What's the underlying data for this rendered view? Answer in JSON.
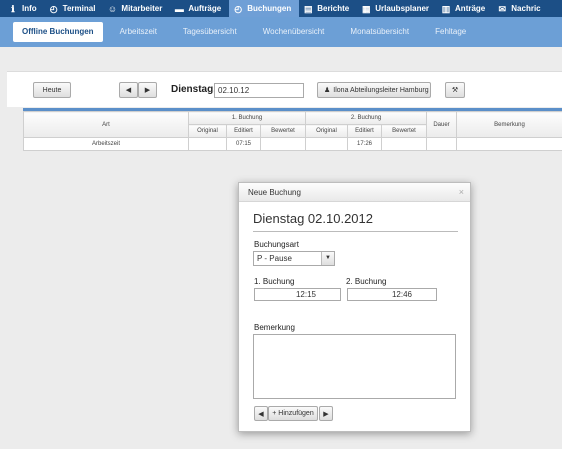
{
  "topnav": {
    "items": [
      {
        "label": "Info",
        "icon": "info-icon",
        "glyph": "ℹ"
      },
      {
        "label": "Terminal",
        "icon": "clock-icon",
        "glyph": "◴"
      },
      {
        "label": "Mitarbeiter",
        "icon": "users-icon",
        "glyph": "☺"
      },
      {
        "label": "Aufträge",
        "icon": "folder-icon",
        "glyph": "▬"
      },
      {
        "label": "Buchungen",
        "icon": "clock-icon",
        "glyph": "◴"
      },
      {
        "label": "Berichte",
        "icon": "report-icon",
        "glyph": "▤"
      },
      {
        "label": "Urlaubsplaner",
        "icon": "calendar-icon",
        "glyph": "▦"
      },
      {
        "label": "Anträge",
        "icon": "document-icon",
        "glyph": "▥"
      },
      {
        "label": "Nachric",
        "icon": "mail-icon",
        "glyph": "✉"
      }
    ],
    "active_index": 4
  },
  "subnav": {
    "items": [
      "Offline Buchungen",
      "Arbeitszeit",
      "Tagesübersicht",
      "Wochenübersicht",
      "Monatsübersicht",
      "Fehltage"
    ],
    "active_index": 0
  },
  "toolbar": {
    "today_label": "Heute",
    "date_label": "Dienstag,",
    "date_value": "02.10.12",
    "employee_label": "Ilona Abteilungsleiter Hamburg"
  },
  "grid": {
    "headers": {
      "art": "Art",
      "buchung1": "1. Buchung",
      "buchung2": "2. Buchung",
      "original": "Original",
      "editiert": "Editiert",
      "bewertet": "Bewertet",
      "dauer": "Dauer",
      "bemerkung": "Bemerkung"
    },
    "rows": [
      {
        "art": "Arbeitszeit",
        "b1_original": "",
        "b1_editiert": "07:15",
        "b1_bewertet": "",
        "b2_original": "",
        "b2_editiert": "17:26",
        "b2_bewertet": "",
        "dauer": "",
        "bemerkung": ""
      }
    ]
  },
  "dialog": {
    "header": "Neue Buchung",
    "close": "×",
    "title": "Dienstag 02.10.2012",
    "buchungsart_label": "Buchungsart",
    "buchungsart_value": "P - Pause",
    "buchung1_label": "1. Buchung",
    "buchung1_value": "12:15",
    "buchung2_label": "2. Buchung",
    "buchung2_value": "12:46",
    "bemerkung_label": "Bemerkung",
    "bemerkung_value": "",
    "add_label": "+ Hinzufügen"
  }
}
